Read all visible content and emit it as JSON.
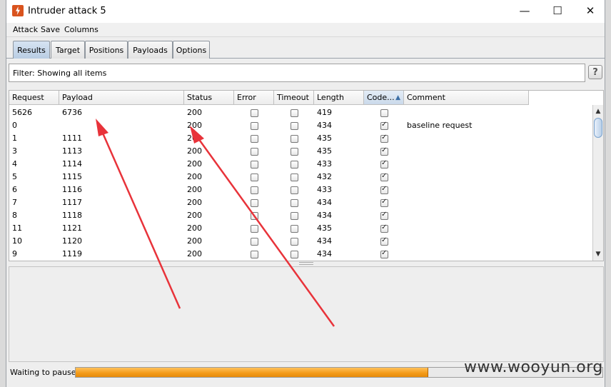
{
  "window": {
    "title": "Intruder attack 5",
    "controls": {
      "minimize": "—",
      "maximize": "☐",
      "close": "✕"
    }
  },
  "menu": [
    "Attack",
    "Save",
    "Columns"
  ],
  "tabs": [
    {
      "label": "Results",
      "active": true
    },
    {
      "label": "Target",
      "active": false
    },
    {
      "label": "Positions",
      "active": false
    },
    {
      "label": "Payloads",
      "active": false
    },
    {
      "label": "Options",
      "active": false
    }
  ],
  "filter": {
    "text": "Filter:  Showing all items",
    "help": "?"
  },
  "table": {
    "columns": [
      "Request",
      "Payload",
      "Status",
      "Error",
      "Timeout",
      "Length",
      "Code...",
      "Comment"
    ],
    "sorted_column": "Code...",
    "rows": [
      {
        "request": "5626",
        "payload": "6736",
        "status": "200",
        "error": false,
        "timeout": false,
        "length": "419",
        "code": false,
        "comment": ""
      },
      {
        "request": "0",
        "payload": "",
        "status": "200",
        "error": false,
        "timeout": false,
        "length": "434",
        "code": true,
        "comment": "baseline request"
      },
      {
        "request": "1",
        "payload": "1111",
        "status": "200",
        "error": false,
        "timeout": false,
        "length": "435",
        "code": true,
        "comment": ""
      },
      {
        "request": "3",
        "payload": "1113",
        "status": "200",
        "error": false,
        "timeout": false,
        "length": "435",
        "code": true,
        "comment": ""
      },
      {
        "request": "4",
        "payload": "1114",
        "status": "200",
        "error": false,
        "timeout": false,
        "length": "433",
        "code": true,
        "comment": ""
      },
      {
        "request": "5",
        "payload": "1115",
        "status": "200",
        "error": false,
        "timeout": false,
        "length": "432",
        "code": true,
        "comment": ""
      },
      {
        "request": "6",
        "payload": "1116",
        "status": "200",
        "error": false,
        "timeout": false,
        "length": "433",
        "code": true,
        "comment": ""
      },
      {
        "request": "7",
        "payload": "1117",
        "status": "200",
        "error": false,
        "timeout": false,
        "length": "434",
        "code": true,
        "comment": ""
      },
      {
        "request": "8",
        "payload": "1118",
        "status": "200",
        "error": false,
        "timeout": false,
        "length": "434",
        "code": true,
        "comment": ""
      },
      {
        "request": "11",
        "payload": "1121",
        "status": "200",
        "error": false,
        "timeout": false,
        "length": "435",
        "code": true,
        "comment": ""
      },
      {
        "request": "10",
        "payload": "1120",
        "status": "200",
        "error": false,
        "timeout": false,
        "length": "434",
        "code": true,
        "comment": ""
      },
      {
        "request": "9",
        "payload": "1119",
        "status": "200",
        "error": false,
        "timeout": false,
        "length": "434",
        "code": true,
        "comment": ""
      }
    ]
  },
  "status": {
    "text": "Waiting to pause",
    "progress": 0.67
  },
  "watermark": "www.wooyun.org",
  "colors": {
    "progress": "#f39a17",
    "arrow": "#e8333a",
    "active_tab": "#c3d5ea"
  }
}
